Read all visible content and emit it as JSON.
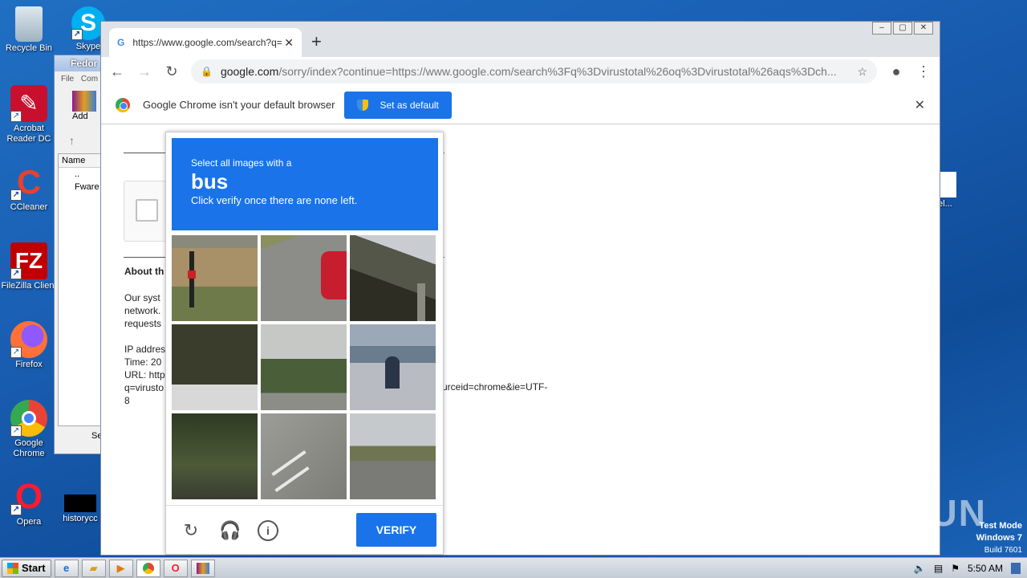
{
  "desktop": {
    "icons": [
      {
        "label": "Recycle Bin"
      },
      {
        "label": "Skype"
      },
      {
        "label": "Acrobat Reader DC"
      },
      {
        "label": "CCleaner"
      },
      {
        "label": "FileZilla Client"
      },
      {
        "label": "Firefox"
      },
      {
        "label": "Google Chrome"
      },
      {
        "label": "Opera"
      },
      {
        "label": "historycc"
      },
      {
        "label": "el..."
      }
    ],
    "watermark": "ANY RUN",
    "test_mode": {
      "line1": "Test Mode",
      "line2": "Windows 7",
      "line3": "Build 7601"
    }
  },
  "explorer": {
    "title": "Fedor",
    "menu_file": "File",
    "menu_com": "Com",
    "add_label": "Add",
    "col_name": "Name",
    "row1": "..",
    "row2": "Fware",
    "status": "Se"
  },
  "browser": {
    "tab_title": "https://www.google.com/search?q=",
    "url_host": "google.com",
    "url_path": "/sorry/index?continue=https://www.google.com/search%3Fq%3Dvirustotal%26oq%3Dvirustotal%26aqs%3Dch...",
    "infobar_text": "Google Chrome isn't your default browser",
    "set_default_label": "Set as default"
  },
  "page": {
    "about_heading": "About th",
    "para1_l1": "Our syst",
    "para1_l2": "network.",
    "para1_l3": "requests",
    "ip_label": "IP addres",
    "time_label": "Time: 20",
    "url_label": "URL: http",
    "url_line2": "q=virusto",
    "url_line3": "8",
    "url_tail": "urceid=chrome&ie=UTF-"
  },
  "captcha": {
    "instruction": "Select all images with a",
    "target": "bus",
    "hint": "Click verify once there are none left.",
    "verify_label": "VERIFY"
  },
  "taskbar": {
    "start_label": "Start",
    "clock": "5:50 AM"
  }
}
